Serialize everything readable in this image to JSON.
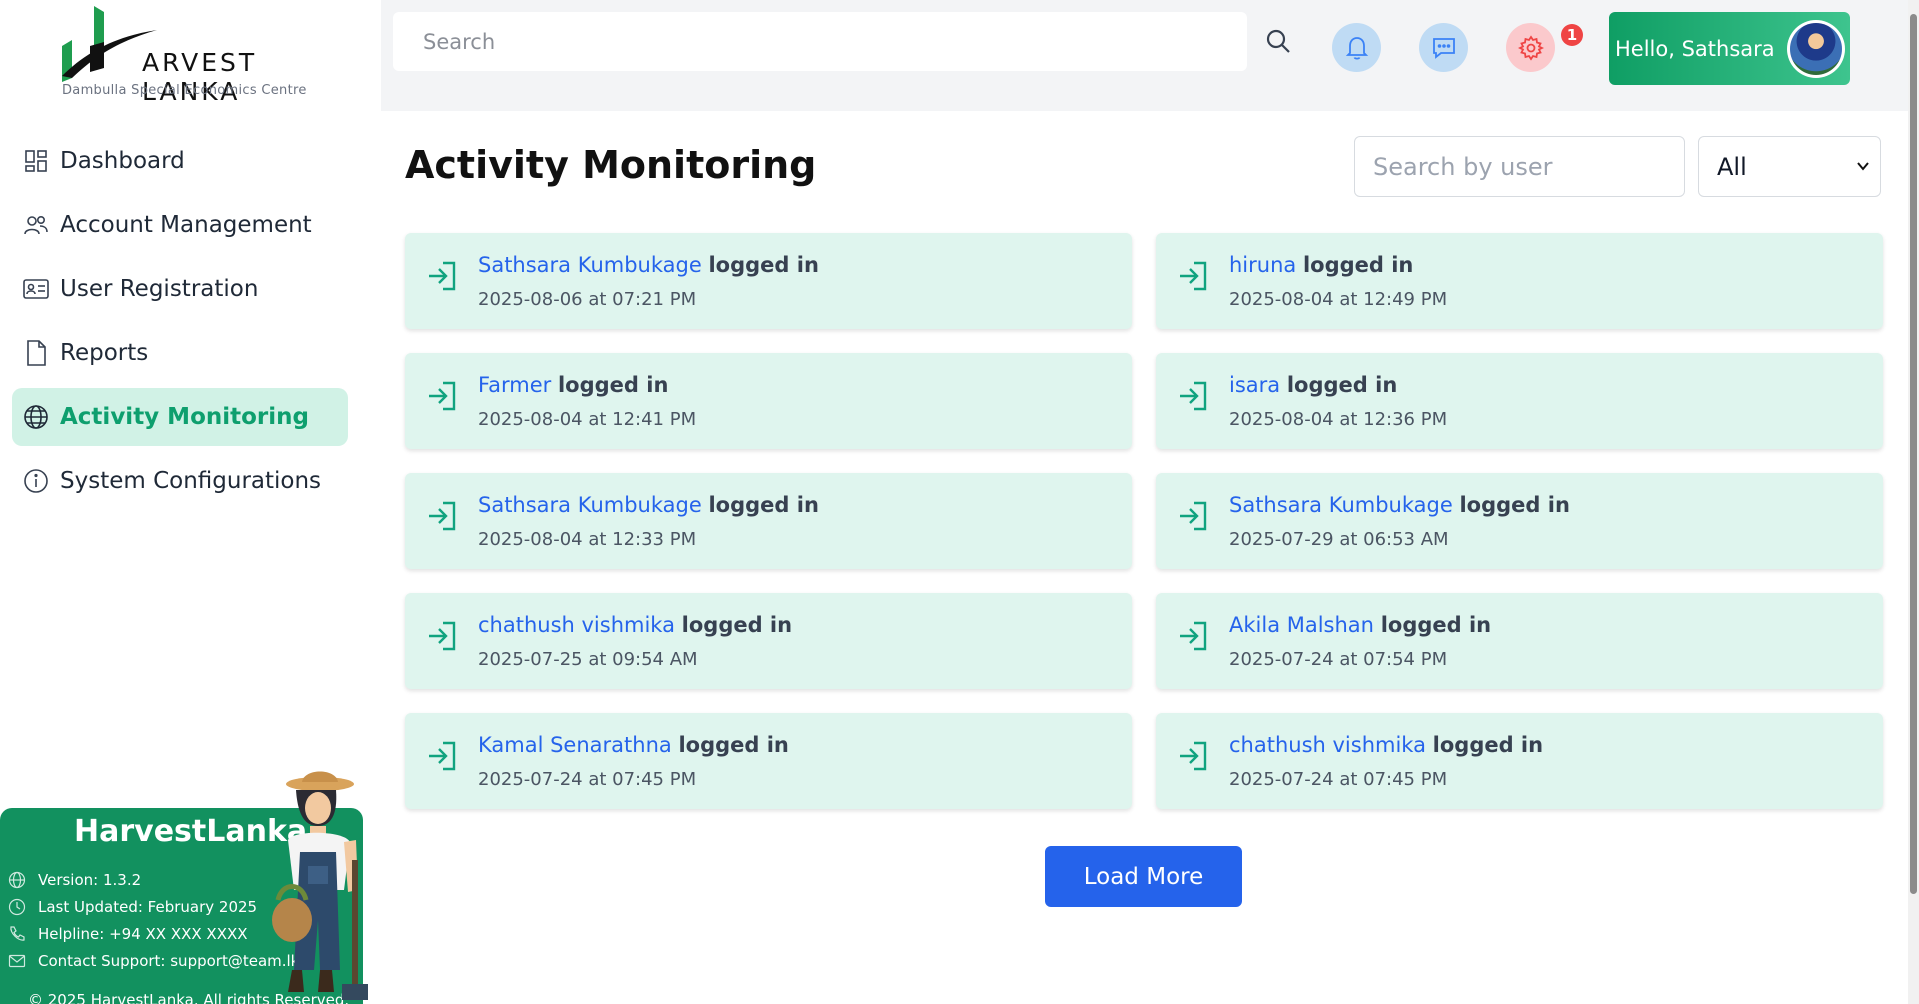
{
  "brand": {
    "logo_text": "ARVEST LANKA",
    "tagline": "Dambulla Special Economics Centre",
    "accent": "#0e9f6e"
  },
  "sidebar": {
    "items": [
      {
        "label": "Dashboard",
        "icon": "grid-icon"
      },
      {
        "label": "Account Management",
        "icon": "users-icon"
      },
      {
        "label": "User Registration",
        "icon": "id-card-icon"
      },
      {
        "label": "Reports",
        "icon": "document-icon"
      },
      {
        "label": "Activity Monitoring",
        "icon": "globe-icon",
        "active": true
      },
      {
        "label": "System Configurations",
        "icon": "info-icon"
      }
    ]
  },
  "info_card": {
    "title": "HarvestLanka",
    "version": "Version: 1.3.2",
    "last_updated": "Last Updated: February 2025",
    "helpline": "Helpline: +94 XX XXX XXXX",
    "support": "Contact Support: support@team.lk",
    "copyright": "© 2025 HarvestLanka. All rights Reserved."
  },
  "header": {
    "search_placeholder": "Search",
    "notification_count": "1",
    "greeting": "Hello, Sathsara"
  },
  "main": {
    "title": "Activity Monitoring",
    "user_search_placeholder": "Search by user",
    "filter_value": "All",
    "load_more": "Load More",
    "activities": [
      {
        "user": "Sathsara Kumbukage",
        "action": "logged in",
        "time": "2025-08-06 at 07:21 PM"
      },
      {
        "user": "hiruna",
        "action": "logged in",
        "time": "2025-08-04 at 12:49 PM"
      },
      {
        "user": "Farmer",
        "action": "logged in",
        "time": "2025-08-04 at 12:41 PM"
      },
      {
        "user": "isara",
        "action": "logged in",
        "time": "2025-08-04 at 12:36 PM"
      },
      {
        "user": "Sathsara Kumbukage",
        "action": "logged in",
        "time": "2025-08-04 at 12:33 PM"
      },
      {
        "user": "Sathsara Kumbukage",
        "action": "logged in",
        "time": "2025-07-29 at 06:53 AM"
      },
      {
        "user": "chathush vishmika",
        "action": "logged in",
        "time": "2025-07-25 at 09:54 AM"
      },
      {
        "user": "Akila Malshan",
        "action": "logged in",
        "time": "2025-07-24 at 07:54 PM"
      },
      {
        "user": "Kamal Senarathna",
        "action": "logged in",
        "time": "2025-07-24 at 07:45 PM"
      },
      {
        "user": "chathush vishmika",
        "action": "logged in",
        "time": "2025-07-24 at 07:45 PM"
      }
    ]
  }
}
